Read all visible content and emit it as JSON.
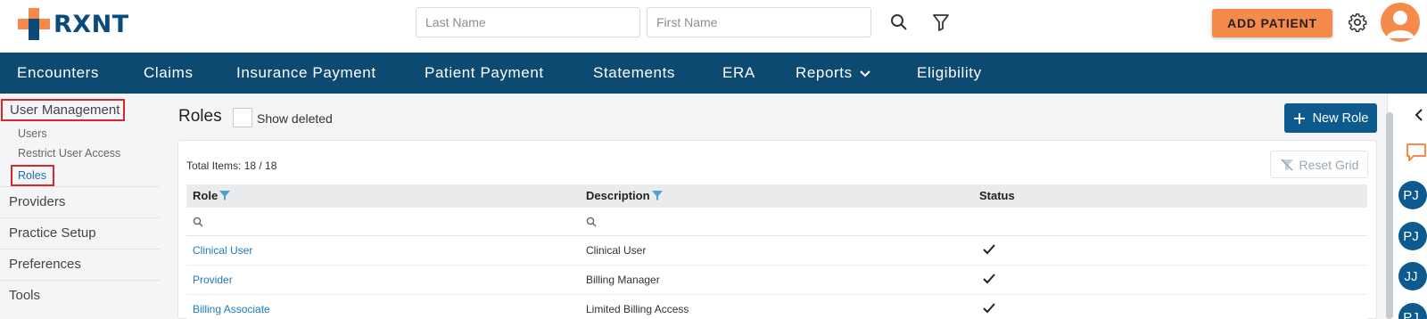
{
  "brand": {
    "name": "RXNT",
    "primary": "#0d4a72",
    "accent": "#f58a4b"
  },
  "header": {
    "last_name_placeholder": "Last Name",
    "first_name_placeholder": "First Name",
    "search_icon": "search-icon",
    "filter_icon": "filter-icon",
    "add_patient_label": "ADD PATIENT",
    "settings_icon": "gear-icon",
    "avatar_icon": "user-avatar"
  },
  "nav": {
    "items": [
      {
        "label": "Encounters"
      },
      {
        "label": "Claims"
      },
      {
        "label": "Insurance Payment"
      },
      {
        "label": "Patient Payment"
      },
      {
        "label": "Statements"
      },
      {
        "label": "ERA"
      },
      {
        "label": "Reports"
      },
      {
        "label": "Eligibility"
      }
    ]
  },
  "sidebar": {
    "section": "User Management",
    "sub_items": [
      {
        "label": "Users"
      },
      {
        "label": "Restrict User Access"
      },
      {
        "label": "Roles"
      }
    ],
    "items": [
      {
        "label": "Providers"
      },
      {
        "label": "Practice Setup"
      },
      {
        "label": "Preferences"
      },
      {
        "label": "Tools"
      }
    ]
  },
  "main": {
    "title": "Roles",
    "show_deleted_label": "Show deleted",
    "new_role_label": "New Role",
    "total_items": "Total Items: 18 / 18",
    "reset_grid_label": "Reset Grid",
    "columns": [
      "Role",
      "Description",
      "Status"
    ],
    "rows": [
      {
        "role": "Clinical User",
        "description": "Clinical User",
        "status": "active"
      },
      {
        "role": "Provider",
        "description": "Billing Manager",
        "status": "active"
      },
      {
        "role": "Billing Associate",
        "description": "Limited Billing Access",
        "status": "active"
      }
    ]
  },
  "rail": {
    "collapse_icon": "chevron-left-icon",
    "chat_icon": "chat-icon",
    "users": [
      {
        "initials": "PJ"
      },
      {
        "initials": "PJ"
      },
      {
        "initials": "JJ"
      },
      {
        "initials": "PJ"
      }
    ]
  }
}
